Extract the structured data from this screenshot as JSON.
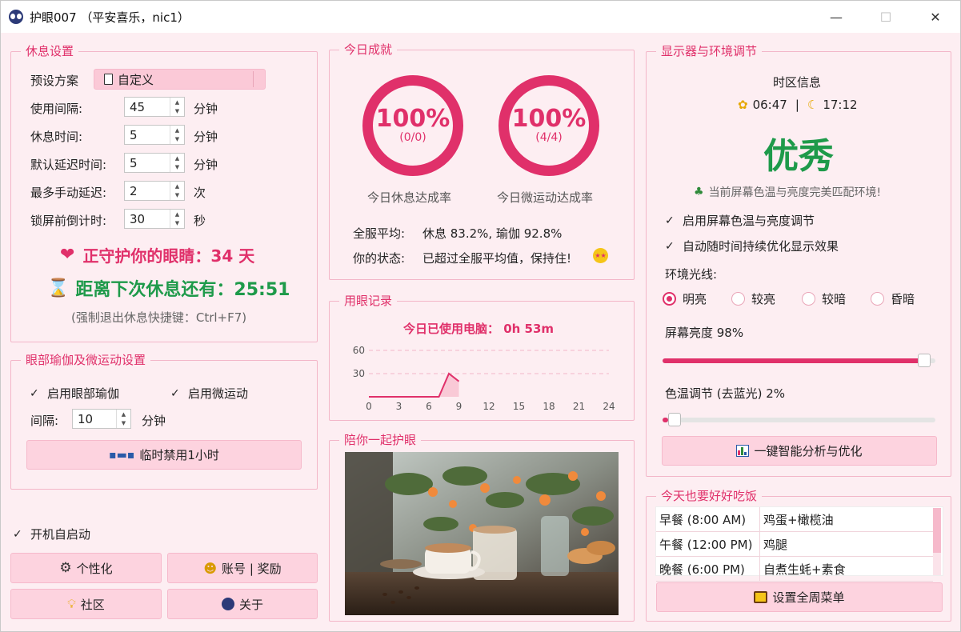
{
  "window": {
    "title": "护眼007 （平安喜乐，nic1）",
    "minimize": "—",
    "maximize": "☐",
    "close": "✕"
  },
  "rest": {
    "title": "休息设置",
    "preset_label": "预设方案",
    "preset_value": "自定义",
    "fields": [
      {
        "label": "使用间隔:",
        "value": "45",
        "unit": "分钟"
      },
      {
        "label": "休息时间:",
        "value": "5",
        "unit": "分钟"
      },
      {
        "label": "默认延迟时间:",
        "value": "5",
        "unit": "分钟"
      },
      {
        "label": "最多手动延迟:",
        "value": "2",
        "unit": "次"
      },
      {
        "label": "锁屏前倒计时:",
        "value": "30",
        "unit": "秒"
      }
    ],
    "guard_text": "正守护你的眼睛：34 天",
    "next_text": "距离下次休息还有：25:51",
    "hotkey_text": "(强制退出休息快捷键：Ctrl+F7)"
  },
  "yoga": {
    "title": "眼部瑜伽及微运动设置",
    "enable_yoga": "启用眼部瑜伽",
    "enable_micro": "启用微运动",
    "interval_label": "间隔:",
    "interval_value": "10",
    "interval_unit": "分钟",
    "disable_button": "临时禁用1小时"
  },
  "autostart_label": "开机自启动",
  "bottom_buttons": {
    "personalize": "个性化",
    "account": "账号 | 奖励",
    "community": "社区",
    "about": "关于"
  },
  "achieve": {
    "title": "今日成就",
    "rest_rate": {
      "value": "100%",
      "detail": "(0/0)",
      "caption": "今日休息达成率"
    },
    "micro_rate": {
      "value": "100%",
      "detail": "(4/4)",
      "caption": "今日微运动达成率"
    },
    "avg_label": "全服平均:",
    "avg_value": "休息 83.2%, 瑜伽 92.8%",
    "status_label": "你的状态:",
    "status_value": "已超过全服平均值，保持住!"
  },
  "usage": {
    "title": "用眼记录",
    "today_text": "今日已使用电脑：  0h 53m",
    "y_ticks": [
      "60",
      "30"
    ],
    "x_ticks": [
      "0",
      "3",
      "6",
      "9",
      "12",
      "15",
      "18",
      "21",
      "24"
    ]
  },
  "chart_data": {
    "type": "area",
    "x": [
      0,
      7,
      8,
      9
    ],
    "y": [
      0,
      0,
      30,
      20
    ],
    "xlim": [
      0,
      24
    ],
    "ylim": [
      0,
      60
    ],
    "grid": true
  },
  "photo": {
    "title": "陪你一起护眼"
  },
  "display": {
    "title": "显示器与环境调节",
    "tz_label": "时区信息",
    "sunrise": "06:47",
    "sunset": "17:12",
    "separator": "|",
    "rating": "优秀",
    "rating_desc": "当前屏幕色温与亮度完美匹配环境!",
    "enable_adjust": "启用屏幕色温与亮度调节",
    "enable_auto": "自动随时间持续优化显示效果",
    "ambient_label": "环境光线:",
    "ambient_options": [
      "明亮",
      "较亮",
      "较暗",
      "昏暗"
    ],
    "ambient_selected": 0,
    "brightness_label": "屏幕亮度 98%",
    "brightness_value": 98,
    "colortemp_label": "色温调节 (去蓝光) 2%",
    "colortemp_value": 2,
    "optimize_button": "一键智能分析与优化",
    "accent": "#e0306a"
  },
  "meals": {
    "title": "今天也要好好吃饭",
    "rows": [
      {
        "time": "早餐 (8:00 AM)",
        "food": "鸡蛋+橄榄油"
      },
      {
        "time": "午餐 (12:00 PM)",
        "food": "鸡腿"
      },
      {
        "time": "晚餐 (6:00 PM)",
        "food": "自煮生蚝+素食"
      }
    ],
    "week_button": "设置全周菜单"
  }
}
